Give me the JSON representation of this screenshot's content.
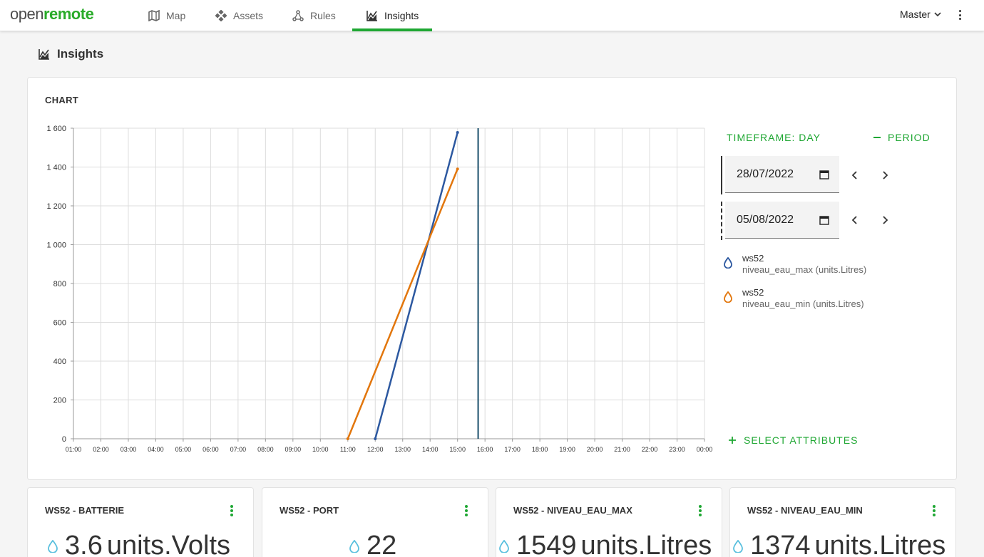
{
  "header": {
    "logo_part1": "open",
    "logo_part2": "remote",
    "tabs": [
      {
        "label": "Map",
        "icon": "map-icon"
      },
      {
        "label": "Assets",
        "icon": "assets-icon"
      },
      {
        "label": "Rules",
        "icon": "rules-icon"
      },
      {
        "label": "Insights",
        "icon": "insights-icon",
        "active": true
      }
    ],
    "realm": "Master"
  },
  "page": {
    "title": "Insights"
  },
  "chart_panel": {
    "title": "CHART",
    "timeframe_label": "TIMEFRAME: DAY",
    "period_label": "PERIOD",
    "date_from": "28/07/2022",
    "date_to": "05/08/2022",
    "select_attributes_label": "SELECT ATTRIBUTES",
    "legend": [
      {
        "asset": "ws52",
        "attribute": "niveau_eau_max (units.Litres)",
        "color": "#2c58a0"
      },
      {
        "asset": "ws52",
        "attribute": "niveau_eau_min (units.Litres)",
        "color": "#e2760c"
      }
    ]
  },
  "chart_data": {
    "type": "line",
    "x_ticks": [
      "01:00",
      "02:00",
      "03:00",
      "04:00",
      "05:00",
      "06:00",
      "07:00",
      "08:00",
      "09:00",
      "10:00",
      "11:00",
      "12:00",
      "13:00",
      "14:00",
      "15:00",
      "16:00",
      "17:00",
      "18:00",
      "19:00",
      "20:00",
      "21:00",
      "22:00",
      "23:00",
      "00:00"
    ],
    "y_ticks": [
      "0",
      "200",
      "400",
      "600",
      "800",
      "1 000",
      "1 200",
      "1 400",
      "1 600"
    ],
    "ylim": [
      0,
      1600
    ],
    "xlim": [
      "01:00",
      "00:00"
    ],
    "now_marker": "15:45",
    "grid": true,
    "series": [
      {
        "color": "#2c58a0",
        "points": [
          {
            "x": "12:00",
            "y": 0
          },
          {
            "x": "15:00",
            "y": 1578
          }
        ]
      },
      {
        "color": "#e2760c",
        "points": [
          {
            "x": "11:00",
            "y": 0
          },
          {
            "x": "15:00",
            "y": 1390
          }
        ]
      }
    ]
  },
  "cards": [
    {
      "title": "WS52 - BATTERIE",
      "value": "3.6",
      "unit": "units.Volts"
    },
    {
      "title": "WS52 - PORT",
      "value": "22",
      "unit": ""
    },
    {
      "title": "WS52 - NIVEAU_EAU_MAX",
      "value": "1549",
      "unit": "units.Litres"
    },
    {
      "title": "WS52 - NIVEAU_EAU_MIN",
      "value": "1374",
      "unit": "units.Litres"
    }
  ]
}
